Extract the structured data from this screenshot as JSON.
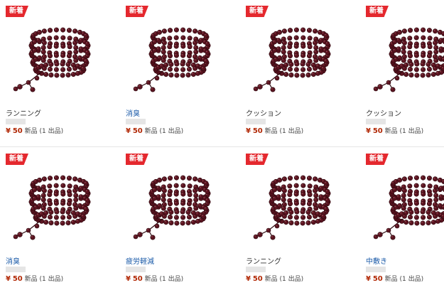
{
  "colors": {
    "badge": "#e4282e",
    "price": "#b12704",
    "link": "#1a5aa8"
  },
  "items": [
    {
      "badge": "新着",
      "title": "ランニング",
      "sub": "",
      "currency": "¥",
      "price": "50",
      "condition": "新品",
      "offers": "(1 出品)"
    },
    {
      "badge": "新着",
      "title": "消臭",
      "sub": "",
      "currency": "¥",
      "price": "50",
      "condition": "新品",
      "offers": "(1 出品)"
    },
    {
      "badge": "新着",
      "title": "クッション",
      "sub": "",
      "currency": "¥",
      "price": "50",
      "condition": "新品",
      "offers": "(1 出品)"
    },
    {
      "badge": "新着",
      "title": "クッション",
      "sub": "",
      "currency": "¥",
      "price": "50",
      "condition": "新品",
      "offers": "(1 出品)"
    },
    {
      "badge": "新着",
      "title": "消臭",
      "sub": "",
      "currency": "¥",
      "price": "50",
      "condition": "新品",
      "offers": "(1 出品)"
    },
    {
      "badge": "新着",
      "title": "疲労軽減",
      "sub": "",
      "currency": "¥",
      "price": "50",
      "condition": "新品",
      "offers": "(1 出品)"
    },
    {
      "badge": "新着",
      "title": "ランニング",
      "sub": "",
      "currency": "¥",
      "price": "50",
      "condition": "新品",
      "offers": "(1 出品)"
    },
    {
      "badge": "新着",
      "title": "中敷き",
      "sub": "",
      "currency": "¥",
      "price": "50",
      "condition": "新品",
      "offers": "(1 出品)"
    }
  ]
}
